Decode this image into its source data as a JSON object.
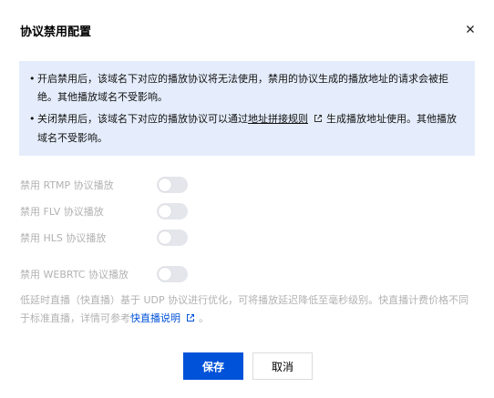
{
  "dialog": {
    "title": "协议禁用配置"
  },
  "notice": {
    "items": [
      {
        "text": "开启禁用后，该域名下对应的播放协议将无法使用，禁用的协议生成的播放地址的请求会被拒绝。其他播放域名不受影响。"
      },
      {
        "text_before": "关闭禁用后，该域名下对应的播放协议可以通过",
        "link": "地址拼接规则",
        "text_after": "生成播放地址使用。其他播放域名不受影响。"
      }
    ]
  },
  "toggles": [
    {
      "label": "禁用 RTMP 协议播放",
      "enabled": false
    },
    {
      "label": "禁用 FLV 协议播放",
      "enabled": false
    },
    {
      "label": "禁用 HLS 协议播放",
      "enabled": false
    },
    {
      "label": "禁用 WEBRTC 协议播放",
      "enabled": false
    }
  ],
  "webrtc_note": {
    "text": "低延时直播（快直播）基于 UDP 协议进行优化，可将播放延迟降低至毫秒级别。快直播计费价格不同于标准直播，详情可参考",
    "link": "快直播说明",
    "suffix": "。"
  },
  "footer": {
    "save_label": "保存",
    "cancel_label": "取消"
  },
  "colors": {
    "primary": "#0052d9",
    "notice_bg": "#e5edfc",
    "disabled_text": "#b2b2b2",
    "toggle_off": "#e4e6eb"
  },
  "icons": {
    "close": "close-icon",
    "external": "external-link-icon"
  }
}
